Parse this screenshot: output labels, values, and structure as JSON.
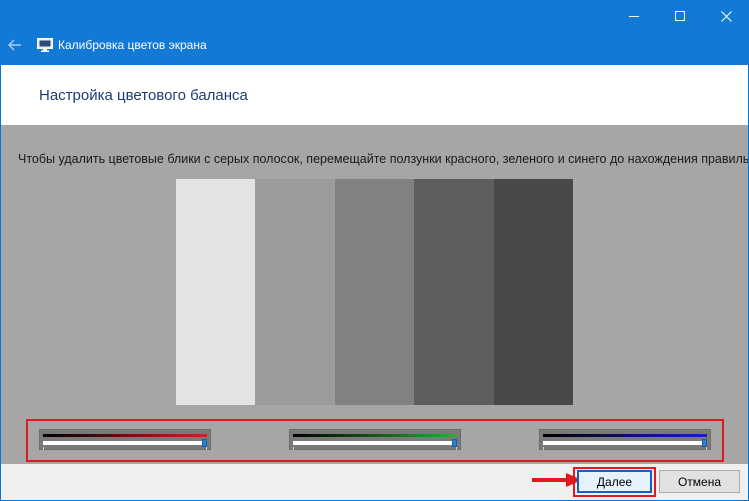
{
  "window": {
    "title": "Калибровка цветов экрана",
    "icons": {
      "back": "back-arrow-icon",
      "app": "monitor-calibration-icon",
      "minimize": "minimize-icon",
      "maximize": "maximize-icon",
      "close": "close-icon"
    }
  },
  "header": {
    "title": "Настройка цветового баланса"
  },
  "content": {
    "instructions": "Чтобы удалить цветовые блики с серых полосок, перемещайте ползунки красного, зеленого и синего до нахождения правильного баланса.",
    "gray_bars": [
      "#e3e3e3",
      "#9c9c9c",
      "#818181",
      "#5e5e5e",
      "#484848"
    ]
  },
  "sliders": [
    {
      "name": "red",
      "color": "#d42020",
      "value": 1.0
    },
    {
      "name": "green",
      "color": "#2dae2d",
      "value": 1.0
    },
    {
      "name": "blue",
      "color": "#1c1cd0",
      "value": 1.0
    }
  ],
  "footer": {
    "next_label": "Далее",
    "cancel_label": "Отмена"
  },
  "colors": {
    "titlebar": "#1379d6",
    "highlight": "#e01820",
    "heading": "#1f3b75"
  }
}
